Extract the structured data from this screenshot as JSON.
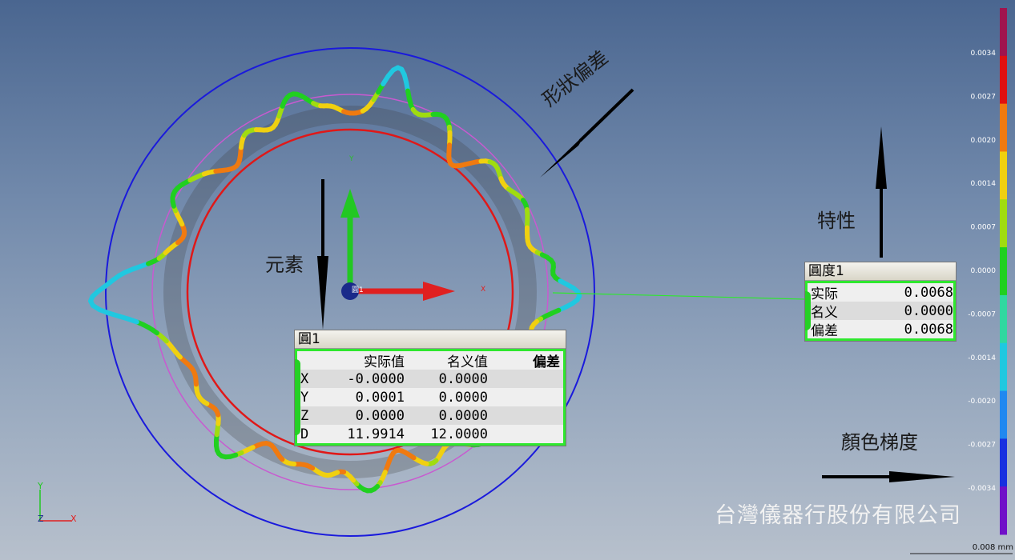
{
  "circle_panel": {
    "title": "圓1",
    "headers": [
      "",
      "实际值",
      "名义值",
      "偏差"
    ],
    "rows": [
      {
        "axis": "X",
        "actual": "-0.0000",
        "nominal": "0.0000",
        "deviation": ""
      },
      {
        "axis": "Y",
        "actual": "0.0001",
        "nominal": "0.0000",
        "deviation": ""
      },
      {
        "axis": "Z",
        "actual": "0.0000",
        "nominal": "0.0000",
        "deviation": ""
      },
      {
        "axis": "D",
        "actual": "11.9914",
        "nominal": "12.0000",
        "deviation": ""
      }
    ]
  },
  "roundness_panel": {
    "title": "圓度1",
    "rows": [
      {
        "label": "实际",
        "value": "0.0068"
      },
      {
        "label": "名义",
        "value": "0.0000"
      },
      {
        "label": "偏差",
        "value": "0.0068"
      }
    ]
  },
  "annotations": {
    "form_deviation": "形狀偏差",
    "feature": "特性",
    "element": "元素",
    "color_gradient": "顏色梯度"
  },
  "company": "台灣儀器行股份有限公司",
  "feature_label": "圓1",
  "axes": {
    "x": "X",
    "y": "Y",
    "z": "Z"
  },
  "color_scale": {
    "labels": [
      "0.0034",
      "0.0027",
      "0.0020",
      "0.0014",
      "0.0007",
      "0.0000",
      "-0.0007",
      "-0.0014",
      "-0.0020",
      "-0.0027",
      "-0.0034"
    ],
    "colors": [
      "#a0144e",
      "#e01010",
      "#f07a10",
      "#f0d010",
      "#a0dc10",
      "#20d020",
      "#30d8a0",
      "#20c8e0",
      "#2088f0",
      "#1830e0",
      "#7010c8"
    ],
    "scale_text": "0.008 mm"
  },
  "accent_colors": {
    "panel_border": "#2ee82e",
    "outer_circle": "#1a1adc",
    "inner_circle": "#e01818"
  }
}
